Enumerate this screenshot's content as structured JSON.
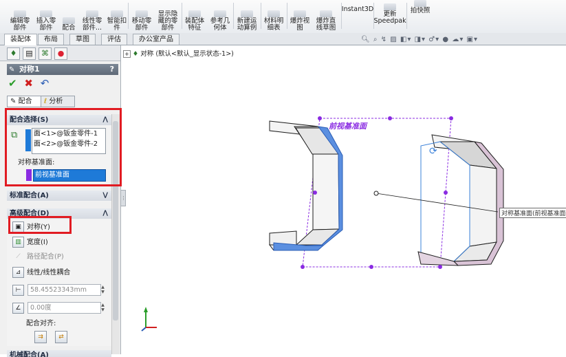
{
  "ribbon": {
    "buttons": [
      {
        "label": "编辑零\n部件"
      },
      {
        "label": "插入零\n部件"
      },
      {
        "label": "配合"
      },
      {
        "label": "线性零\n部件..."
      },
      {
        "label": "智能扣\n件"
      },
      {
        "label": "移动零\n部件"
      },
      {
        "label": "显示隐\n藏的零\n部件"
      },
      {
        "label": "装配体\n特征"
      },
      {
        "label": "参考几\n何体"
      },
      {
        "label": "新建运\n动算例"
      },
      {
        "label": "材料明\n细表"
      },
      {
        "label": "爆炸视\n图"
      },
      {
        "label": "爆炸直\n线草图"
      },
      {
        "label": "Instant3D"
      },
      {
        "label": "更新\nSpeedpak"
      },
      {
        "label": "拍快照"
      }
    ]
  },
  "command_tabs": [
    "装配体",
    "布局",
    "草图",
    "评估",
    "办公室产品"
  ],
  "feature_tree": {
    "root": "对称 (默认<默认_显示状态-1>)"
  },
  "property_manager": {
    "title": "对称1",
    "help": "?",
    "ok": "✔",
    "cancel": "✖",
    "undo": "↶",
    "tabs": [
      "配合",
      "分析"
    ],
    "mate_selection": {
      "header": "配合选择(S)",
      "items": [
        "面<1>@钣金零件-1",
        "面<2>@钣金零件-2"
      ],
      "plane_label": "对称基准面:",
      "plane_value": "前视基准面"
    },
    "standard_header": "标准配合(A)",
    "advanced_header": "高级配合(D)",
    "advanced_options": {
      "symmetric": "对称(Y)",
      "width": "宽度(I)",
      "path": "路径配合(P)",
      "linear": "线性/线性耦合",
      "distance": "58.45523343mm",
      "angle": "0.00度",
      "alignment_label": "配合对齐:"
    },
    "mechanical_header": "机械配合(A)"
  },
  "viewport": {
    "plane_name": "前视基准面",
    "plane_callout": "对称基准面(前视基准面)",
    "colors": {
      "plane": "#8a2be2",
      "left_face": "#5b8fe0",
      "right_face": "#d9c3d6",
      "part_fill": "#f2f2f2",
      "part_shade": "#c9c9c9",
      "edge": "#1c1c1c"
    }
  }
}
